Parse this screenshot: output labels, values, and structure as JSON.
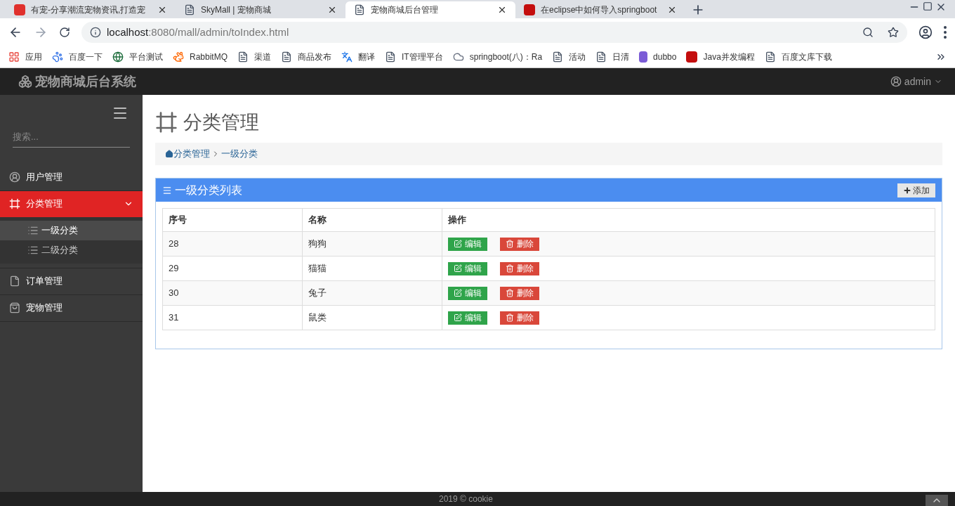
{
  "browser": {
    "tabs": [
      {
        "title": "有宠-分享潮流宠物资讯,打造宠",
        "selected": false,
        "kind": "pet"
      },
      {
        "title": "SkyMall | 宠物商城",
        "selected": false,
        "kind": "page"
      },
      {
        "title": "宠物商城后台管理",
        "selected": true,
        "kind": "page"
      },
      {
        "title": "在eclipse中如何导入springboot",
        "selected": false,
        "kind": "c"
      }
    ],
    "url_host": "localhost",
    "url_rest": ":8080/mall/admin/toIndex.html",
    "bookmarks": [
      {
        "label": "应用",
        "kind": "apps"
      },
      {
        "label": "百度一下",
        "kind": "paw"
      },
      {
        "label": "平台测试",
        "kind": "globe"
      },
      {
        "label": "RabbitMQ",
        "kind": "rabbit"
      },
      {
        "label": "渠道",
        "kind": "page"
      },
      {
        "label": "商品发布",
        "kind": "page"
      },
      {
        "label": "翻译",
        "kind": "translate"
      },
      {
        "label": "IT管理平台",
        "kind": "page"
      },
      {
        "label": "springboot(八)：Ra",
        "kind": "cloud"
      },
      {
        "label": "活动",
        "kind": "page"
      },
      {
        "label": "日清",
        "kind": "page"
      },
      {
        "label": "dubbo",
        "kind": "d"
      },
      {
        "label": "Java并发编程",
        "kind": "c"
      },
      {
        "label": "百度文库下载",
        "kind": "page"
      }
    ]
  },
  "header": {
    "brand": "宠物商城后台系统",
    "user": "admin"
  },
  "sidebar": {
    "search_placeholder": "搜索...",
    "items": [
      {
        "label": "用户管理",
        "kind": "user",
        "selected": false
      },
      {
        "label": "分类管理",
        "kind": "frame",
        "selected": true,
        "expanded": true,
        "children": [
          {
            "label": "一级分类",
            "selected": true
          },
          {
            "label": "二级分类",
            "selected": false
          }
        ]
      },
      {
        "label": "订单管理",
        "kind": "file",
        "selected": false
      },
      {
        "label": "宠物管理",
        "kind": "bag",
        "selected": false
      }
    ]
  },
  "page": {
    "title": "分类管理",
    "breadcrumb": [
      "分类管理",
      "一级分类"
    ]
  },
  "panel": {
    "title": "一级分类列表",
    "add_button": "添加",
    "table": {
      "columns": [
        "序号",
        "名称",
        "操作"
      ],
      "rows": [
        {
          "id": "28",
          "name": "狗狗",
          "edit": "编辑",
          "delete": "删除"
        },
        {
          "id": "29",
          "name": "猫猫",
          "edit": "编辑",
          "delete": "删除"
        },
        {
          "id": "30",
          "name": "兔子",
          "edit": "编辑",
          "delete": "删除"
        },
        {
          "id": "31",
          "name": "鼠类",
          "edit": "编辑",
          "delete": "删除"
        }
      ]
    }
  },
  "footer": {
    "text": "2019 © cookie"
  }
}
